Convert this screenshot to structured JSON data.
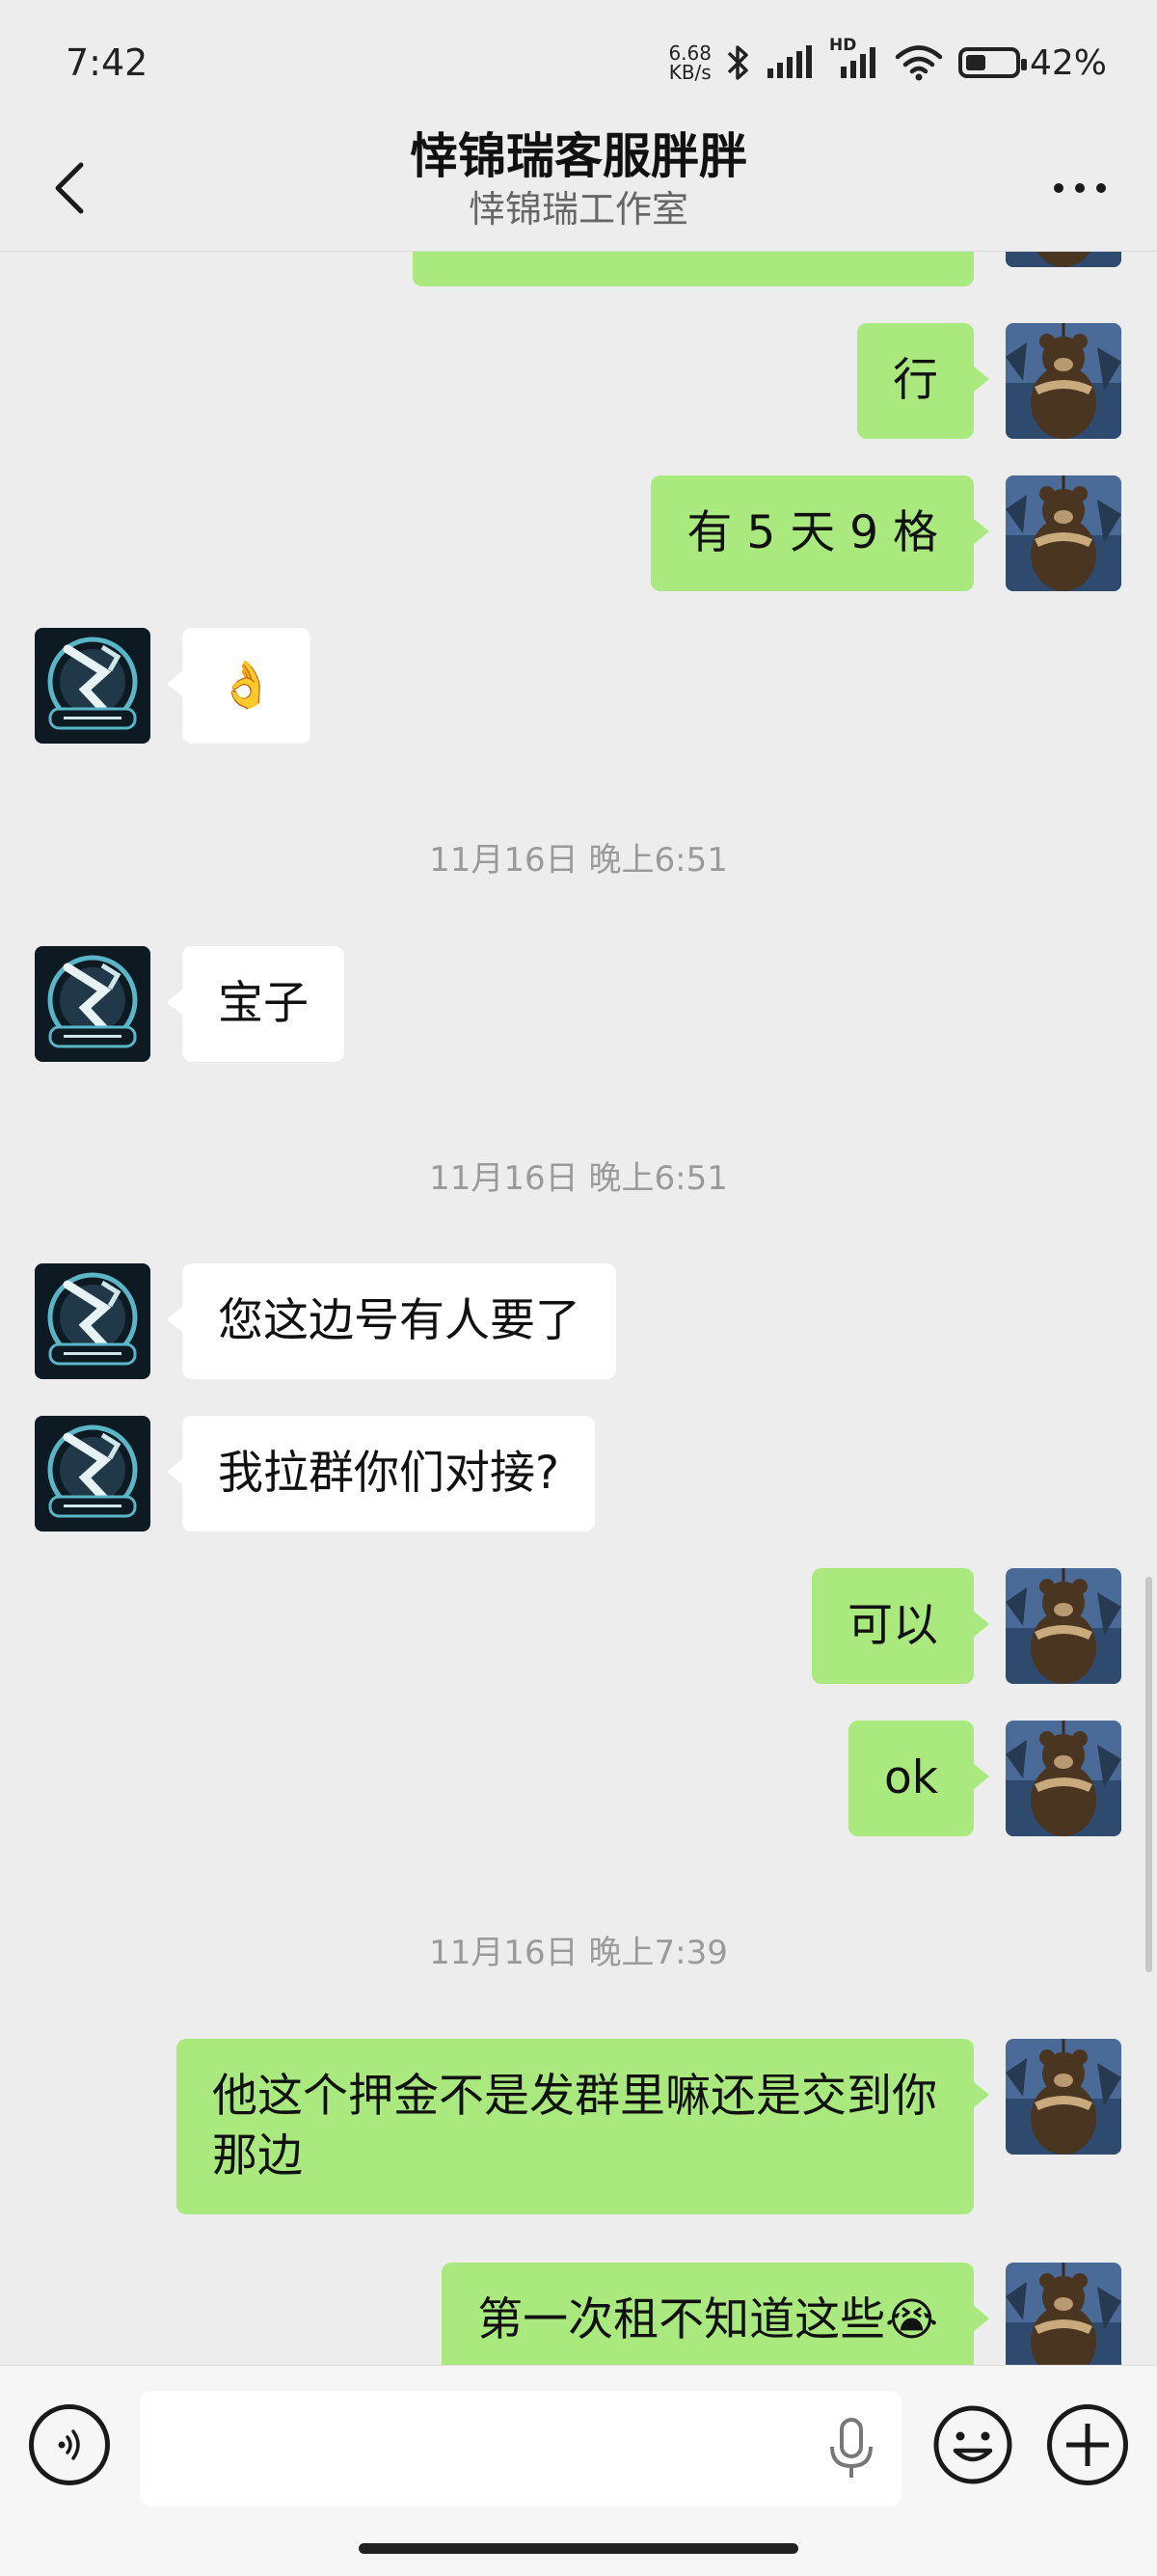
{
  "status_bar": {
    "time": "7:42",
    "net_speed_value": "6.68",
    "net_speed_unit": "KB/s",
    "signal_tag": "HD",
    "battery": "42%",
    "battery_level": 0.42
  },
  "header": {
    "title": "悻锦瑞客服胖胖",
    "subtitle": "悻锦瑞工作室"
  },
  "messages": {
    "m0": "",
    "m1": "行",
    "m2": "有 5 天 9 格",
    "m3": "👌",
    "t1": "11月16日 晚上6:51",
    "m4": "宝子",
    "t2": "11月16日 晚上6:51",
    "m5": "您这边号有人要了",
    "m6": "我拉群你们对接?",
    "m7": "可以",
    "m8": "ok",
    "t3": "11月16日 晚上7:39",
    "m9": "他这个押金不是发群里嘛还是交到你那边",
    "m10": "第一次租不知道这些😭"
  },
  "input": {
    "value": "",
    "placeholder": ""
  },
  "colors": {
    "my_bubble": "#a9e97e",
    "their_bubble": "#ffffff",
    "background": "#ededed"
  }
}
